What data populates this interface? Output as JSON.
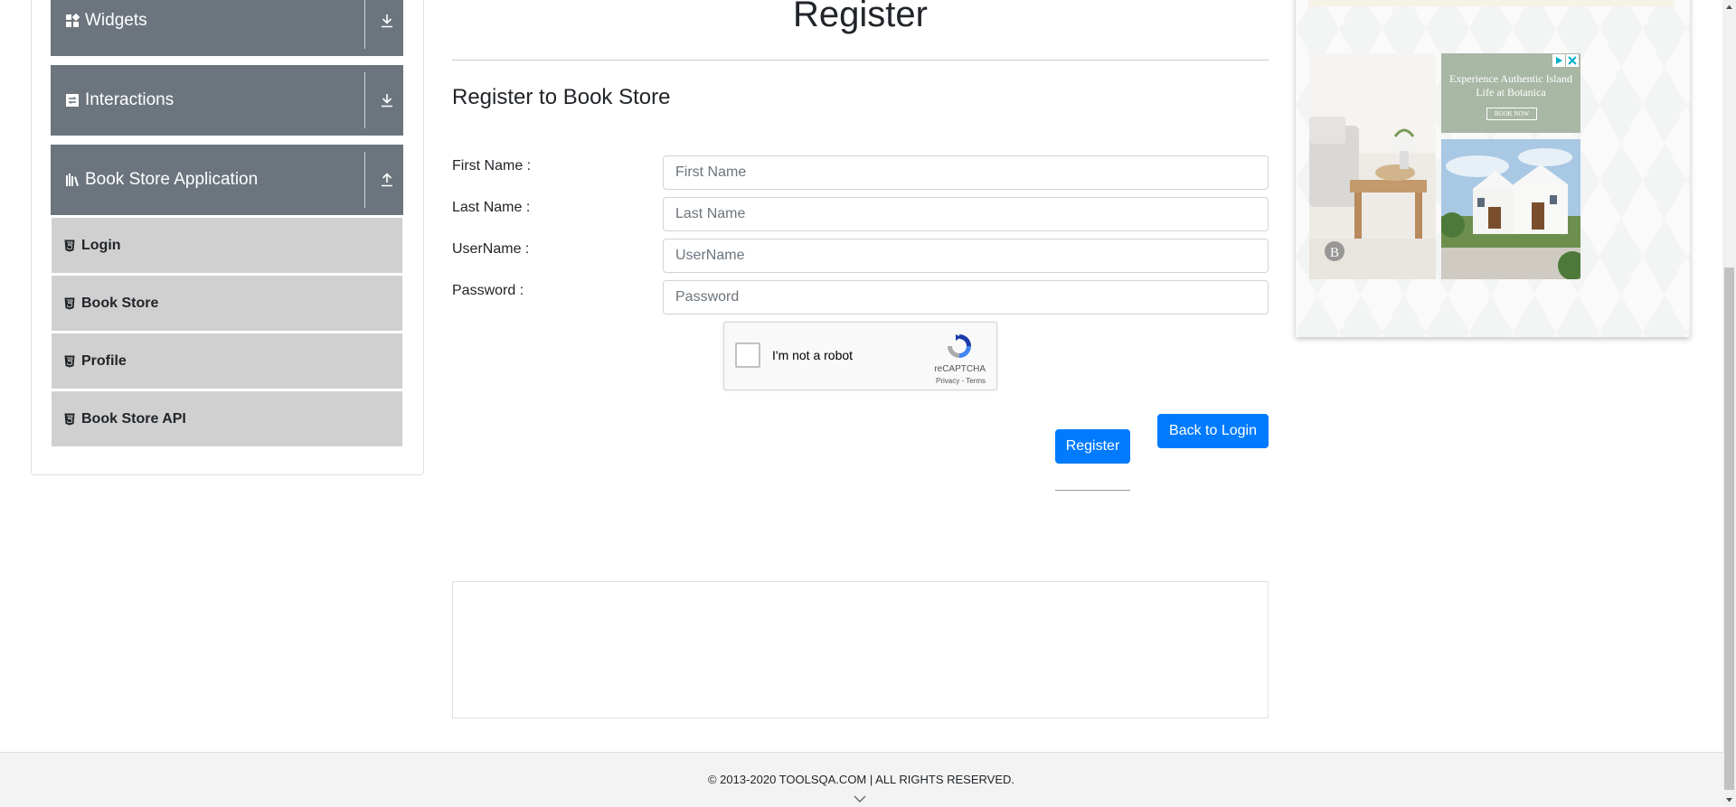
{
  "sidebar": {
    "groups": [
      {
        "label": "Widgets",
        "icon": "widgets-grid-icon",
        "arrow": "download-arrow-icon"
      },
      {
        "label": "Interactions",
        "icon": "interactions-icon",
        "arrow": "download-arrow-icon"
      },
      {
        "label": "Book Store Application",
        "icon": "books-icon",
        "arrow": "upload-arrow-icon"
      }
    ],
    "items": [
      {
        "label": "Login",
        "icon": "html5-icon"
      },
      {
        "label": "Book Store",
        "icon": "html5-icon"
      },
      {
        "label": "Profile",
        "icon": "html5-icon"
      },
      {
        "label": "Book Store API",
        "icon": "html5-icon"
      }
    ]
  },
  "main": {
    "header": "Register",
    "form_title": "Register to Book Store",
    "fields": [
      {
        "label": "First Name :",
        "placeholder": "First Name",
        "value": ""
      },
      {
        "label": "Last Name :",
        "placeholder": "Last Name",
        "value": ""
      },
      {
        "label": "UserName :",
        "placeholder": "UserName",
        "value": ""
      },
      {
        "label": "Password :",
        "placeholder": "Password",
        "value": ""
      }
    ],
    "captcha": {
      "label": "I'm not a robot",
      "brand": "reCAPTCHA",
      "links": "Privacy - Terms",
      "checked": false
    },
    "register_button": "Register",
    "back_button": "Back to Login"
  },
  "ad": {
    "headline": "Experience Authentic Island Life at Botanica",
    "cta": "BOOK NOW",
    "badge": "B"
  },
  "footer": {
    "text": "© 2013-2020 TOOLSQA.COM | ALL RIGHTS RESERVED."
  },
  "colors": {
    "accent": "#007bff",
    "sidebar_header": "#6c757d",
    "sidebar_item": "#d0d0d0"
  }
}
